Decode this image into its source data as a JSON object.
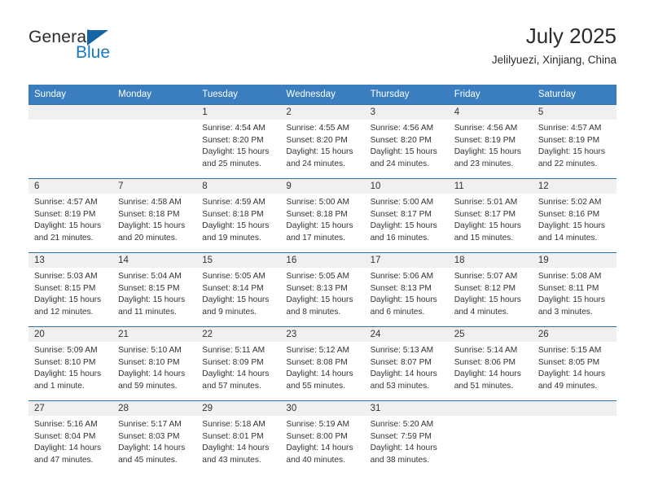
{
  "brand": {
    "name_part1": "General",
    "name_part2": "Blue",
    "accent_color": "#1779c4",
    "triangle_color": "#1565a6",
    "triangle_icon": "triangle-icon"
  },
  "header": {
    "title": "July 2025",
    "subtitle": "Jelilyuezi, Xinjiang, China"
  },
  "calendar": {
    "header_bg": "#3a7ebf",
    "daystrip_bg": "#f0f0f0",
    "weekday_headers": [
      "Sunday",
      "Monday",
      "Tuesday",
      "Wednesday",
      "Thursday",
      "Friday",
      "Saturday"
    ],
    "weeks": [
      [
        {
          "day": "",
          "empty": true,
          "sunrise": "",
          "sunset": "",
          "daylight1": "",
          "daylight2": ""
        },
        {
          "day": "",
          "empty": true,
          "sunrise": "",
          "sunset": "",
          "daylight1": "",
          "daylight2": ""
        },
        {
          "day": "1",
          "sunrise": "Sunrise: 4:54 AM",
          "sunset": "Sunset: 8:20 PM",
          "daylight1": "Daylight: 15 hours",
          "daylight2": "and 25 minutes."
        },
        {
          "day": "2",
          "sunrise": "Sunrise: 4:55 AM",
          "sunset": "Sunset: 8:20 PM",
          "daylight1": "Daylight: 15 hours",
          "daylight2": "and 24 minutes."
        },
        {
          "day": "3",
          "sunrise": "Sunrise: 4:56 AM",
          "sunset": "Sunset: 8:20 PM",
          "daylight1": "Daylight: 15 hours",
          "daylight2": "and 24 minutes."
        },
        {
          "day": "4",
          "sunrise": "Sunrise: 4:56 AM",
          "sunset": "Sunset: 8:19 PM",
          "daylight1": "Daylight: 15 hours",
          "daylight2": "and 23 minutes."
        },
        {
          "day": "5",
          "sunrise": "Sunrise: 4:57 AM",
          "sunset": "Sunset: 8:19 PM",
          "daylight1": "Daylight: 15 hours",
          "daylight2": "and 22 minutes."
        }
      ],
      [
        {
          "day": "6",
          "sunrise": "Sunrise: 4:57 AM",
          "sunset": "Sunset: 8:19 PM",
          "daylight1": "Daylight: 15 hours",
          "daylight2": "and 21 minutes."
        },
        {
          "day": "7",
          "sunrise": "Sunrise: 4:58 AM",
          "sunset": "Sunset: 8:18 PM",
          "daylight1": "Daylight: 15 hours",
          "daylight2": "and 20 minutes."
        },
        {
          "day": "8",
          "sunrise": "Sunrise: 4:59 AM",
          "sunset": "Sunset: 8:18 PM",
          "daylight1": "Daylight: 15 hours",
          "daylight2": "and 19 minutes."
        },
        {
          "day": "9",
          "sunrise": "Sunrise: 5:00 AM",
          "sunset": "Sunset: 8:18 PM",
          "daylight1": "Daylight: 15 hours",
          "daylight2": "and 17 minutes."
        },
        {
          "day": "10",
          "sunrise": "Sunrise: 5:00 AM",
          "sunset": "Sunset: 8:17 PM",
          "daylight1": "Daylight: 15 hours",
          "daylight2": "and 16 minutes."
        },
        {
          "day": "11",
          "sunrise": "Sunrise: 5:01 AM",
          "sunset": "Sunset: 8:17 PM",
          "daylight1": "Daylight: 15 hours",
          "daylight2": "and 15 minutes."
        },
        {
          "day": "12",
          "sunrise": "Sunrise: 5:02 AM",
          "sunset": "Sunset: 8:16 PM",
          "daylight1": "Daylight: 15 hours",
          "daylight2": "and 14 minutes."
        }
      ],
      [
        {
          "day": "13",
          "sunrise": "Sunrise: 5:03 AM",
          "sunset": "Sunset: 8:15 PM",
          "daylight1": "Daylight: 15 hours",
          "daylight2": "and 12 minutes."
        },
        {
          "day": "14",
          "sunrise": "Sunrise: 5:04 AM",
          "sunset": "Sunset: 8:15 PM",
          "daylight1": "Daylight: 15 hours",
          "daylight2": "and 11 minutes."
        },
        {
          "day": "15",
          "sunrise": "Sunrise: 5:05 AM",
          "sunset": "Sunset: 8:14 PM",
          "daylight1": "Daylight: 15 hours",
          "daylight2": "and 9 minutes."
        },
        {
          "day": "16",
          "sunrise": "Sunrise: 5:05 AM",
          "sunset": "Sunset: 8:13 PM",
          "daylight1": "Daylight: 15 hours",
          "daylight2": "and 8 minutes."
        },
        {
          "day": "17",
          "sunrise": "Sunrise: 5:06 AM",
          "sunset": "Sunset: 8:13 PM",
          "daylight1": "Daylight: 15 hours",
          "daylight2": "and 6 minutes."
        },
        {
          "day": "18",
          "sunrise": "Sunrise: 5:07 AM",
          "sunset": "Sunset: 8:12 PM",
          "daylight1": "Daylight: 15 hours",
          "daylight2": "and 4 minutes."
        },
        {
          "day": "19",
          "sunrise": "Sunrise: 5:08 AM",
          "sunset": "Sunset: 8:11 PM",
          "daylight1": "Daylight: 15 hours",
          "daylight2": "and 3 minutes."
        }
      ],
      [
        {
          "day": "20",
          "sunrise": "Sunrise: 5:09 AM",
          "sunset": "Sunset: 8:10 PM",
          "daylight1": "Daylight: 15 hours",
          "daylight2": "and 1 minute."
        },
        {
          "day": "21",
          "sunrise": "Sunrise: 5:10 AM",
          "sunset": "Sunset: 8:10 PM",
          "daylight1": "Daylight: 14 hours",
          "daylight2": "and 59 minutes."
        },
        {
          "day": "22",
          "sunrise": "Sunrise: 5:11 AM",
          "sunset": "Sunset: 8:09 PM",
          "daylight1": "Daylight: 14 hours",
          "daylight2": "and 57 minutes."
        },
        {
          "day": "23",
          "sunrise": "Sunrise: 5:12 AM",
          "sunset": "Sunset: 8:08 PM",
          "daylight1": "Daylight: 14 hours",
          "daylight2": "and 55 minutes."
        },
        {
          "day": "24",
          "sunrise": "Sunrise: 5:13 AM",
          "sunset": "Sunset: 8:07 PM",
          "daylight1": "Daylight: 14 hours",
          "daylight2": "and 53 minutes."
        },
        {
          "day": "25",
          "sunrise": "Sunrise: 5:14 AM",
          "sunset": "Sunset: 8:06 PM",
          "daylight1": "Daylight: 14 hours",
          "daylight2": "and 51 minutes."
        },
        {
          "day": "26",
          "sunrise": "Sunrise: 5:15 AM",
          "sunset": "Sunset: 8:05 PM",
          "daylight1": "Daylight: 14 hours",
          "daylight2": "and 49 minutes."
        }
      ],
      [
        {
          "day": "27",
          "sunrise": "Sunrise: 5:16 AM",
          "sunset": "Sunset: 8:04 PM",
          "daylight1": "Daylight: 14 hours",
          "daylight2": "and 47 minutes."
        },
        {
          "day": "28",
          "sunrise": "Sunrise: 5:17 AM",
          "sunset": "Sunset: 8:03 PM",
          "daylight1": "Daylight: 14 hours",
          "daylight2": "and 45 minutes."
        },
        {
          "day": "29",
          "sunrise": "Sunrise: 5:18 AM",
          "sunset": "Sunset: 8:01 PM",
          "daylight1": "Daylight: 14 hours",
          "daylight2": "and 43 minutes."
        },
        {
          "day": "30",
          "sunrise": "Sunrise: 5:19 AM",
          "sunset": "Sunset: 8:00 PM",
          "daylight1": "Daylight: 14 hours",
          "daylight2": "and 40 minutes."
        },
        {
          "day": "31",
          "sunrise": "Sunrise: 5:20 AM",
          "sunset": "Sunset: 7:59 PM",
          "daylight1": "Daylight: 14 hours",
          "daylight2": "and 38 minutes."
        },
        {
          "day": "",
          "empty": true,
          "sunrise": "",
          "sunset": "",
          "daylight1": "",
          "daylight2": ""
        },
        {
          "day": "",
          "empty": true,
          "sunrise": "",
          "sunset": "",
          "daylight1": "",
          "daylight2": ""
        }
      ]
    ]
  }
}
